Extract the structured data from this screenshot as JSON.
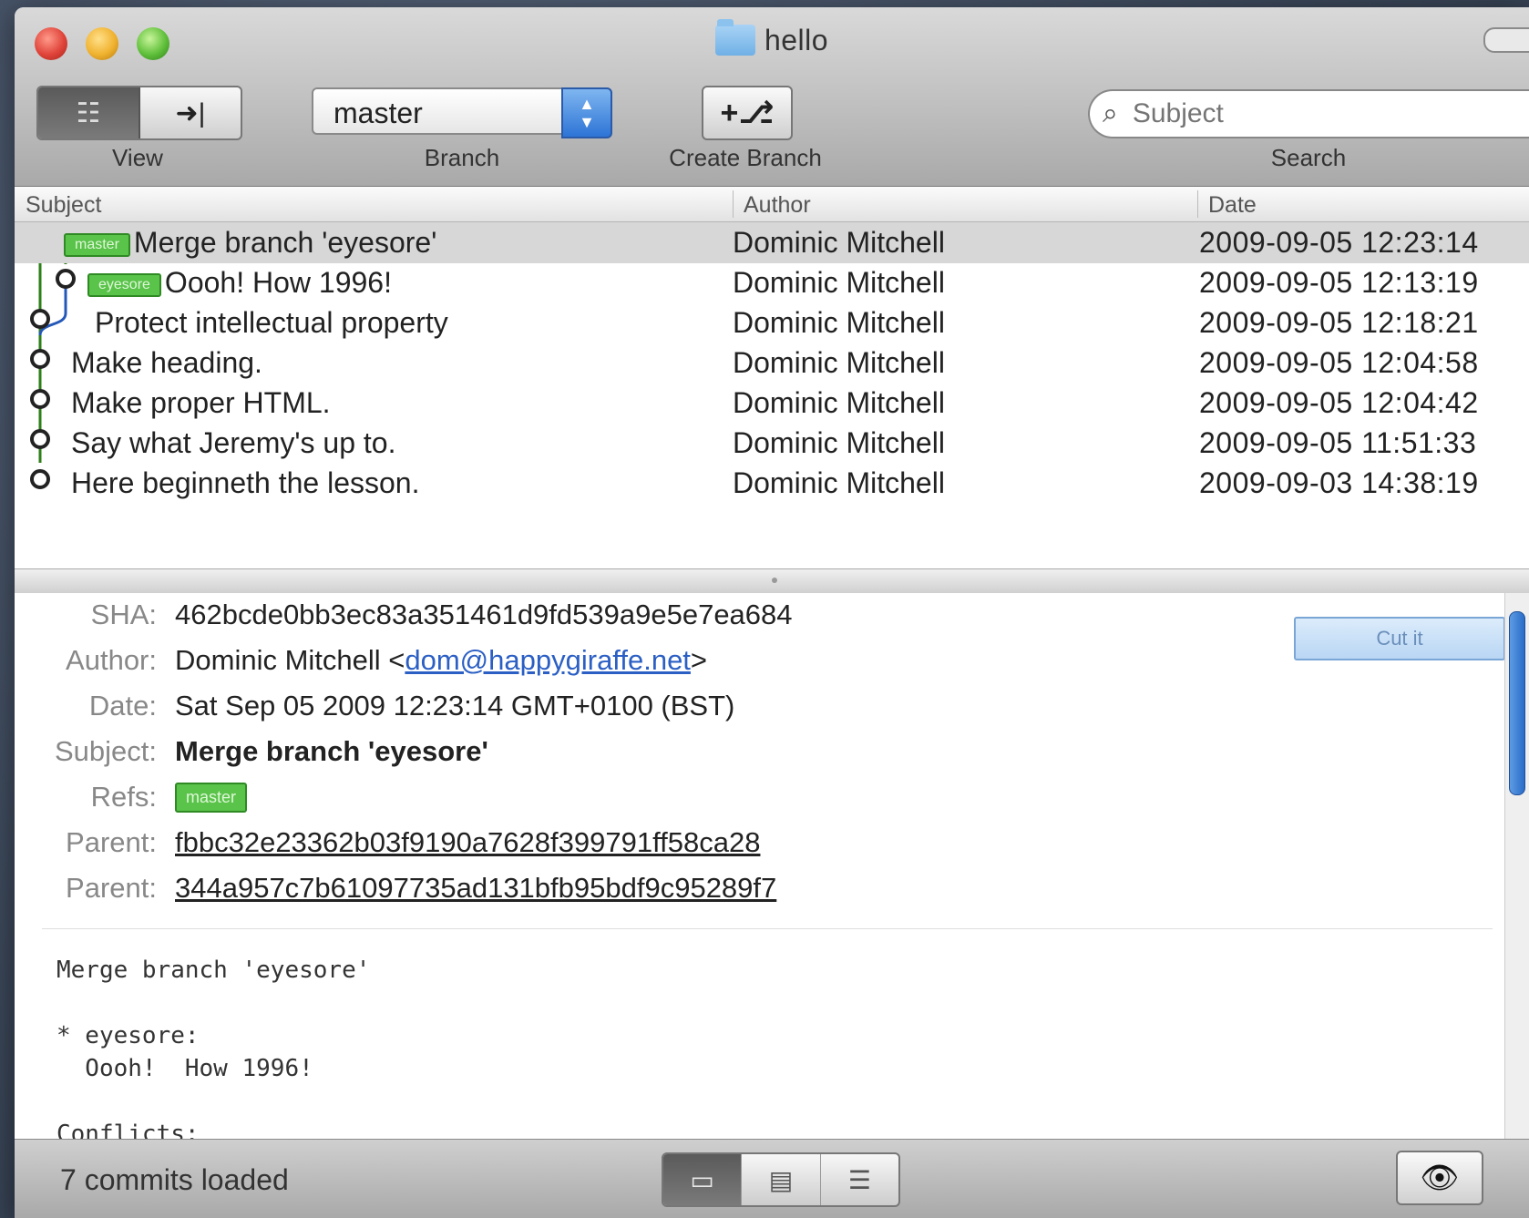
{
  "window": {
    "title": "hello"
  },
  "toolbar": {
    "view_label": "View",
    "branch_label": "Branch",
    "create_branch_label": "Create Branch",
    "search_label": "Search",
    "branch_value": "master",
    "search_placeholder": "Subject"
  },
  "list": {
    "columns": {
      "subject": "Subject",
      "author": "Author",
      "date": "Date"
    },
    "rows": [
      {
        "ref": "master",
        "subject": "Merge branch 'eyesore'",
        "author": "Dominic Mitchell",
        "date": "2009-09-05 12:23:14"
      },
      {
        "ref": "eyesore",
        "subject": "Oooh!  How 1996!",
        "author": "Dominic Mitchell",
        "date": "2009-09-05 12:13:19"
      },
      {
        "ref": "",
        "subject": "Protect intellectual property",
        "author": "Dominic Mitchell",
        "date": "2009-09-05 12:18:21"
      },
      {
        "ref": "",
        "subject": "Make heading.",
        "author": "Dominic Mitchell",
        "date": "2009-09-05 12:04:58"
      },
      {
        "ref": "",
        "subject": "Make proper HTML.",
        "author": "Dominic Mitchell",
        "date": "2009-09-05 12:04:42"
      },
      {
        "ref": "",
        "subject": "Say what Jeremy's up to.",
        "author": "Dominic Mitchell",
        "date": "2009-09-05 11:51:33"
      },
      {
        "ref": "",
        "subject": "Here beginneth the lesson.",
        "author": "Dominic Mitchell",
        "date": "2009-09-03 14:38:19"
      }
    ]
  },
  "detail": {
    "labels": {
      "sha": "SHA:",
      "author": "Author:",
      "date": "Date:",
      "subject": "Subject:",
      "refs": "Refs:",
      "parent": "Parent:"
    },
    "sha": "462bcde0bb3ec83a351461d9fd539a9e5e7ea684",
    "author_name": "Dominic Mitchell <",
    "author_email": "dom@happygiraffe.net",
    "author_close": ">",
    "date": "Sat Sep 05 2009 12:23:14 GMT+0100 (BST)",
    "subject": "Merge branch 'eyesore'",
    "ref": "master",
    "parent1": "fbbc32e23362b03f9190a7628f399791ff58ca28",
    "parent2": "344a957c7b61097735ad131bfb95bdf9c95289f7",
    "checkout_button": "Cut it",
    "message": "Merge branch 'eyesore'\n\n* eyesore:\n  Oooh!  How 1996!\n\nConflicts:"
  },
  "status": {
    "text": "7 commits loaded"
  },
  "colors": {
    "ref_green": "#59c34a",
    "link_blue": "#2b5fc4",
    "selection": "#d7d7d7"
  }
}
